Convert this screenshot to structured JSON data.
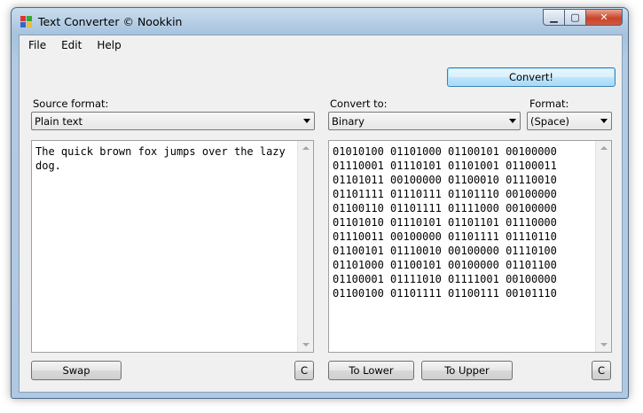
{
  "window": {
    "title": "Text Converter © Nookkin"
  },
  "menu": [
    "File",
    "Edit",
    "Help"
  ],
  "convert_button": "Convert!",
  "source": {
    "label": "Source format:",
    "selected": "Plain text",
    "text": "The quick brown fox jumps over the lazy dog."
  },
  "target": {
    "label": "Convert to:",
    "selected": "Binary",
    "format_label": "Format:",
    "format_selected": "(Space)",
    "text": "01010100 01101000 01100101 00100000 01110001 01110101 01101001 01100011 01101011 00100000 01100010 01110010 01101111 01110111 01101110 00100000 01100110 01101111 01111000 00100000 01101010 01110101 01101101 01110000 01110011 00100000 01101111 01110110 01100101 01110010 00100000 01110100 01101000 01100101 00100000 01101100 01100001 01111010 01111001 00100000 01100100 01101111 01100111 00101110"
  },
  "buttons": {
    "swap": "Swap",
    "clear_left": "C",
    "to_lower": "To Lower",
    "to_upper": "To Upper",
    "clear_right": "C"
  }
}
